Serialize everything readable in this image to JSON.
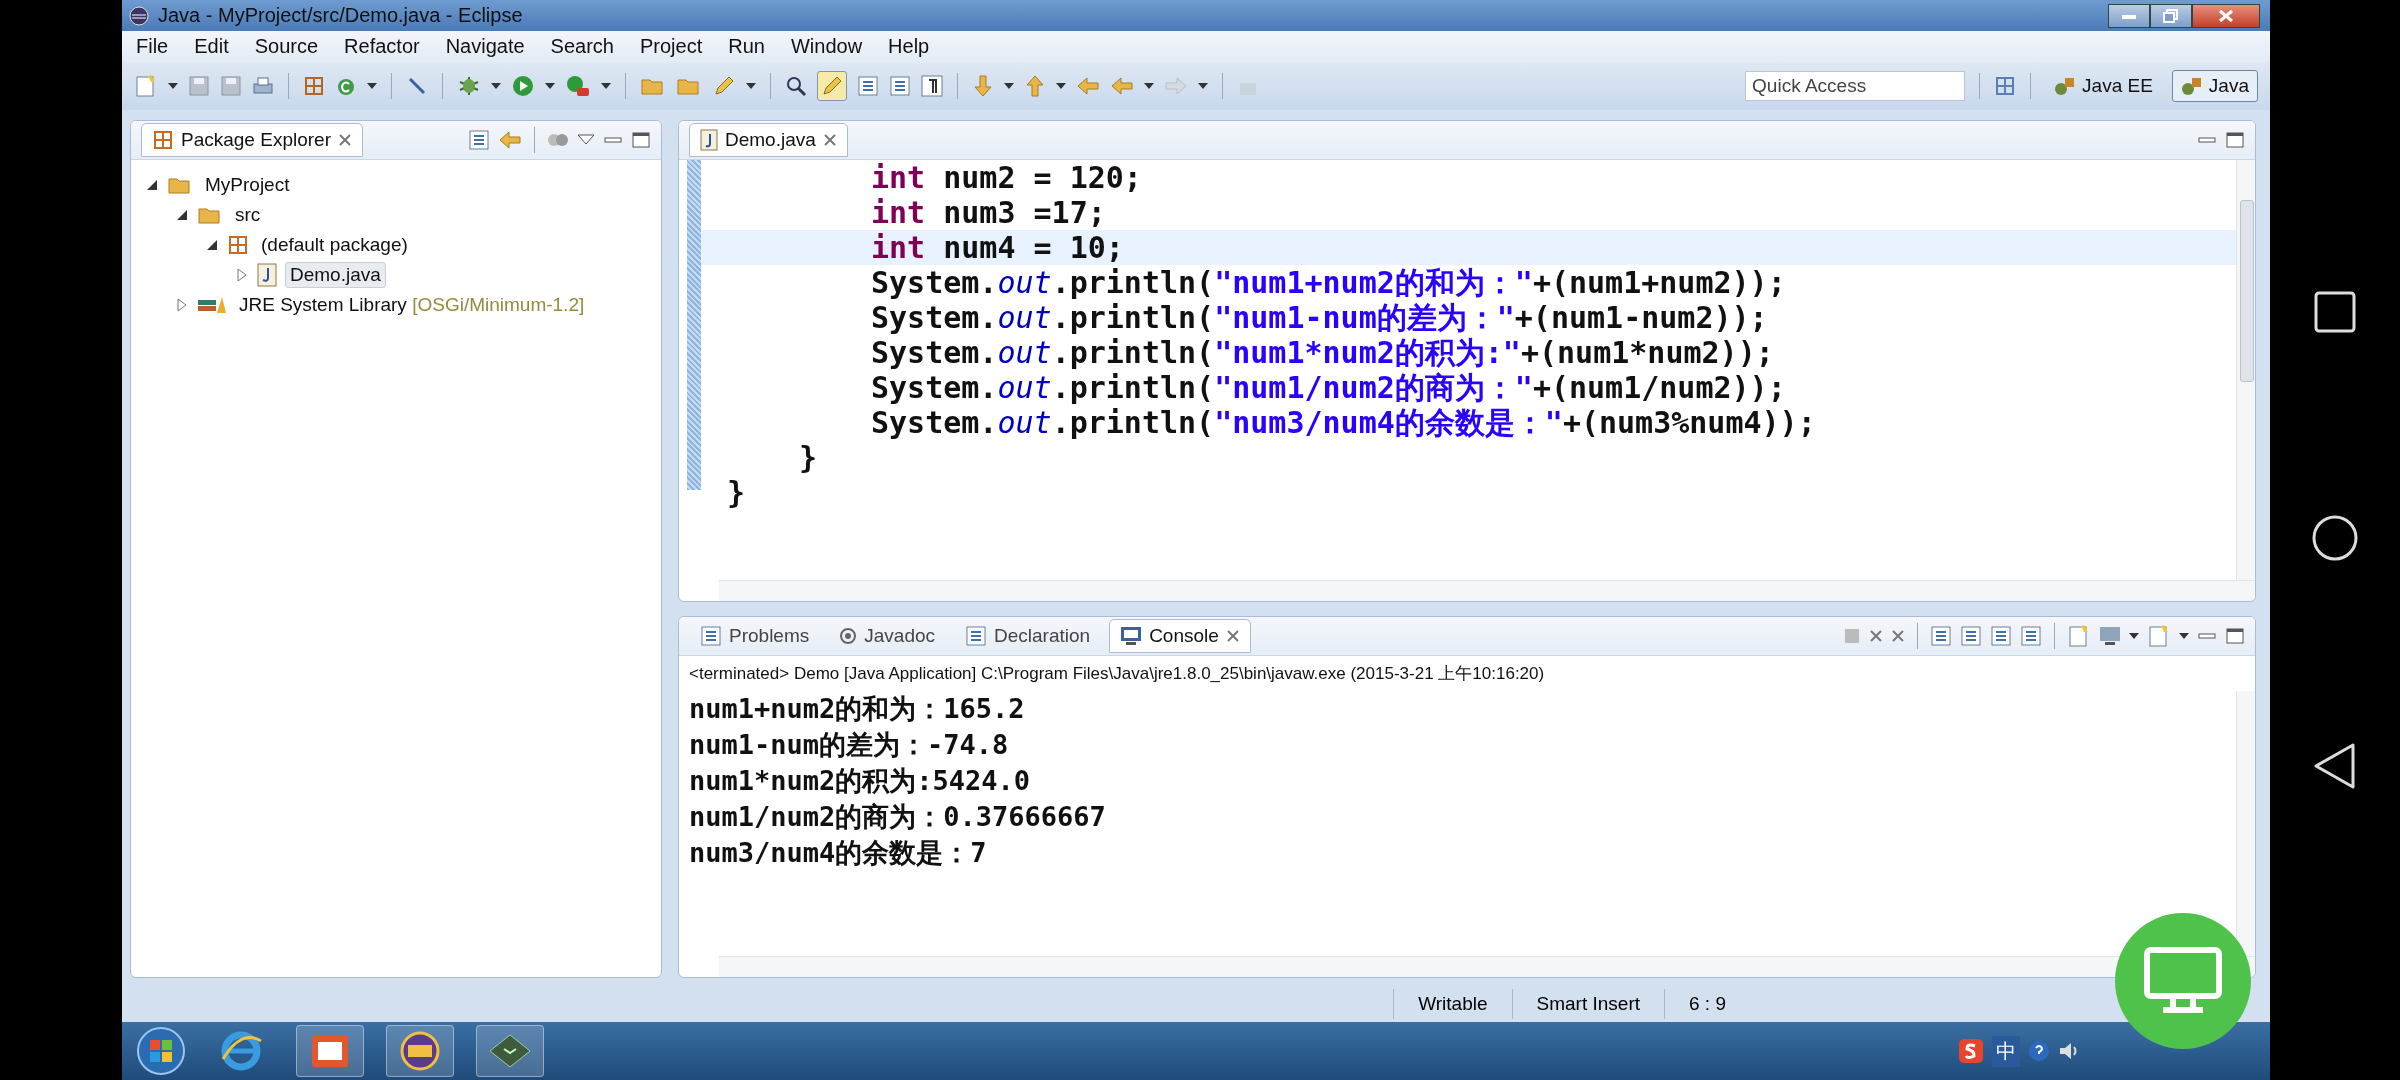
{
  "window": {
    "title": "Java - MyProject/src/Demo.java - Eclipse"
  },
  "menu": [
    "File",
    "Edit",
    "Source",
    "Refactor",
    "Navigate",
    "Search",
    "Project",
    "Run",
    "Window",
    "Help"
  ],
  "quick_access": {
    "placeholder": "Quick Access"
  },
  "perspectives": [
    {
      "label": "Java EE",
      "selected": false
    },
    {
      "label": "Java",
      "selected": true
    }
  ],
  "package_explorer": {
    "title": "Package Explorer",
    "tree": [
      {
        "kind": "project",
        "label": "MyProject",
        "expanded": true,
        "selected": false,
        "children": [
          {
            "kind": "source_folder",
            "label": "src",
            "expanded": true,
            "selected": false,
            "children": [
              {
                "kind": "package",
                "label": "(default package)",
                "expanded": true,
                "selected": false,
                "children": [
                  {
                    "kind": "java_file",
                    "label": "Demo.java",
                    "expanded": false,
                    "selected": true
                  }
                ]
              }
            ]
          },
          {
            "kind": "library",
            "label": "JRE System Library",
            "decoration": "[OSGi/Minimum-1.2]",
            "expanded": false,
            "selected": false
          }
        ]
      }
    ]
  },
  "editor": {
    "tab": "Demo.java",
    "lines": [
      {
        "kind": "statement",
        "current": false,
        "segments": [
          {
            "kind": "keyword",
            "text": "int"
          },
          {
            "kind": "plain",
            "text": " num2 = 120;"
          }
        ]
      },
      {
        "kind": "statement",
        "current": false,
        "segments": [
          {
            "kind": "keyword",
            "text": "int"
          },
          {
            "kind": "plain",
            "text": " num3 =17;"
          }
        ]
      },
      {
        "kind": "statement",
        "current": true,
        "segments": [
          {
            "kind": "keyword",
            "text": "int"
          },
          {
            "kind": "plain",
            "text": " num4 = 10;"
          }
        ]
      },
      {
        "kind": "statement",
        "current": false,
        "segments": [
          {
            "kind": "plain",
            "text": "System."
          },
          {
            "kind": "field",
            "text": "out"
          },
          {
            "kind": "plain",
            "text": ".println("
          },
          {
            "kind": "string",
            "text": "\"num1+num2的和为：\""
          },
          {
            "kind": "plain",
            "text": "+(num1+num2));"
          }
        ]
      },
      {
        "kind": "statement",
        "current": false,
        "segments": [
          {
            "kind": "plain",
            "text": "System."
          },
          {
            "kind": "field",
            "text": "out"
          },
          {
            "kind": "plain",
            "text": ".println("
          },
          {
            "kind": "string",
            "text": "\"num1-num的差为：\""
          },
          {
            "kind": "plain",
            "text": "+(num1-num2));"
          }
        ]
      },
      {
        "kind": "statement",
        "current": false,
        "segments": [
          {
            "kind": "plain",
            "text": "System."
          },
          {
            "kind": "field",
            "text": "out"
          },
          {
            "kind": "plain",
            "text": ".println("
          },
          {
            "kind": "string",
            "text": "\"num1*num2的积为:\""
          },
          {
            "kind": "plain",
            "text": "+(num1*num2));"
          }
        ]
      },
      {
        "kind": "statement",
        "current": false,
        "segments": [
          {
            "kind": "plain",
            "text": "System."
          },
          {
            "kind": "field",
            "text": "out"
          },
          {
            "kind": "plain",
            "text": ".println("
          },
          {
            "kind": "string",
            "text": "\"num1/num2的商为：\""
          },
          {
            "kind": "plain",
            "text": "+(num1/num2));"
          }
        ]
      },
      {
        "kind": "statement",
        "current": false,
        "segments": [
          {
            "kind": "plain",
            "text": "System."
          },
          {
            "kind": "field",
            "text": "out"
          },
          {
            "kind": "plain",
            "text": ".println("
          },
          {
            "kind": "string",
            "text": "\"num3/num4的余数是：\""
          },
          {
            "kind": "plain",
            "text": "+(num3%num4));"
          }
        ]
      },
      {
        "kind": "method_end",
        "current": false,
        "segments": [
          {
            "kind": "plain",
            "text": "}"
          }
        ]
      },
      {
        "kind": "class_end",
        "current": false,
        "segments": [
          {
            "kind": "plain",
            "text": "}"
          }
        ]
      }
    ]
  },
  "bottom_tabs": [
    {
      "label": "Problems",
      "selected": false
    },
    {
      "label": "Javadoc",
      "selected": false
    },
    {
      "label": "Declaration",
      "selected": false
    },
    {
      "label": "Console",
      "selected": true
    }
  ],
  "console": {
    "header": "<terminated> Demo [Java Application] C:\\Program Files\\Java\\jre1.8.0_25\\bin\\javaw.exe (2015-3-21 上午10:16:20)",
    "lines": [
      "num1+num2的和为：165.2",
      "num1-num的差为：-74.8",
      "num1*num2的积为:5424.0",
      "num1/num2的商为：0.37666667",
      "num3/num4的余数是：7"
    ]
  },
  "status_bar": {
    "mode": "Writable",
    "insert": "Smart Insert",
    "position": "6 : 9"
  },
  "taskbar": {
    "ime": "中"
  }
}
